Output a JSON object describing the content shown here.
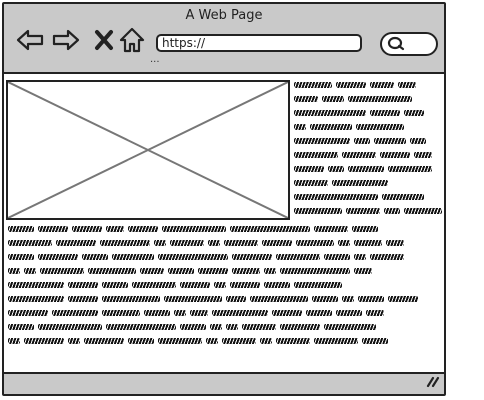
{
  "window": {
    "title": "A Web Page"
  },
  "toolbar": {
    "back_icon": "arrow-left-icon",
    "forward_icon": "arrow-right-icon",
    "stop_icon": "close-icon",
    "home_icon": "home-icon",
    "address_value": "https://",
    "address_hint": "...",
    "search_icon": "search-icon"
  },
  "content": {
    "image": "image-placeholder-icon"
  },
  "statusbar": {
    "grip_icon": "resize-grip-icon"
  },
  "colors": {
    "chrome": "#c9c9c9",
    "ink": "#222222",
    "page": "#ffffff"
  }
}
